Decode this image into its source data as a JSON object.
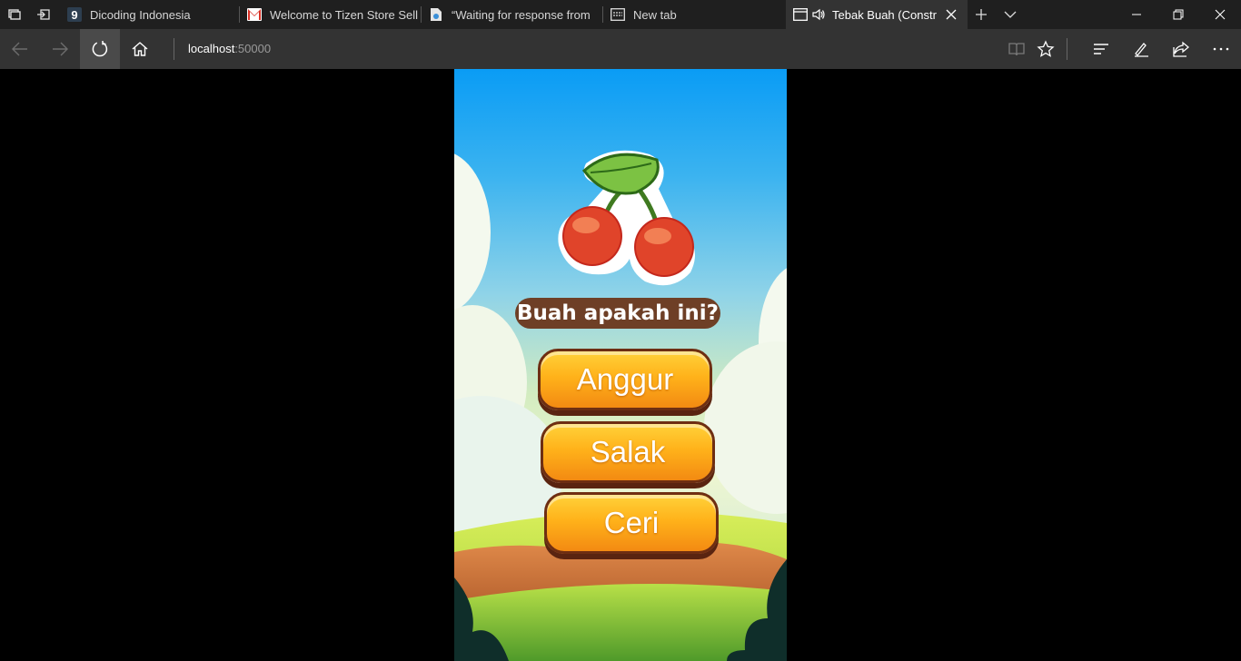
{
  "browser": {
    "tabs": [
      {
        "title": "Dicoding Indonesia",
        "icon": "dicoding-icon"
      },
      {
        "title": "Welcome to Tizen Store Sell",
        "icon": "gmail-icon"
      },
      {
        "title": "“Waiting for response from",
        "icon": "tizen-doc-icon"
      },
      {
        "title": "New tab",
        "icon": "new-tab-icon"
      },
      {
        "title": "Tebak Buah (Constr",
        "icon": "page-icon",
        "active": true,
        "audio": true
      }
    ],
    "address": {
      "host": "localhost",
      "port": ":50000"
    }
  },
  "game": {
    "question": "Buah apakah ini?",
    "image": "cherry-icon",
    "options": [
      "Anggur",
      "Salak",
      "Ceri"
    ]
  },
  "colors": {
    "chrome_dark": "#1f1f1f",
    "chrome_bar": "#333333",
    "button_orange": "#ffb21a",
    "button_border": "#6e2e12",
    "question_bg": "#6e3f26"
  }
}
